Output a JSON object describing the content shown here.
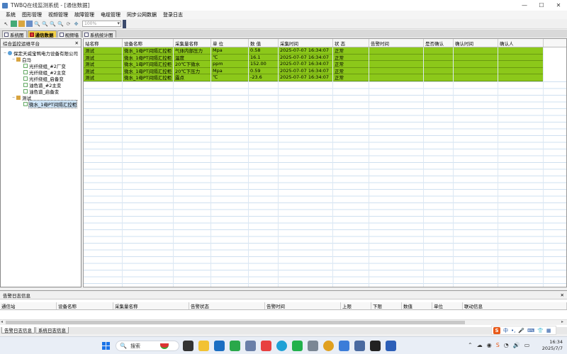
{
  "window": {
    "title": "TWBQ在线监测系统 - [通信数据]",
    "min": "—",
    "max": "☐",
    "close": "✕"
  },
  "menu": [
    "系统",
    "图形管理",
    "视频管理",
    "故障管理",
    "电缆管理",
    "同步公网数据",
    "登录日志"
  ],
  "toolbar": {
    "zoom_placeholder": "100%"
  },
  "tabs": [
    {
      "label": "系统图",
      "active": false
    },
    {
      "label": "通信数据",
      "active": true
    },
    {
      "label": "视频墙",
      "active": false
    },
    {
      "label": "系统统计图",
      "active": false
    }
  ],
  "sidebar": {
    "title": "综合监控运维平台",
    "pin": "✕",
    "tree": [
      {
        "label": "保定天威宝鸭电力设备有限公司",
        "level": 0,
        "icon": "globe",
        "exp": "−"
      },
      {
        "label": "白马",
        "level": 1,
        "icon": "house",
        "exp": "−"
      },
      {
        "label": "光纤绕组_#2厂变",
        "level": 2,
        "icon": "leaf"
      },
      {
        "label": "光纤绕组_#2主变",
        "level": 2,
        "icon": "leaf"
      },
      {
        "label": "光纤绕组_启备变",
        "level": 2,
        "icon": "leaf"
      },
      {
        "label": "油色谱_#2主变",
        "level": 2,
        "icon": "leaf"
      },
      {
        "label": "油色谱_启备变",
        "level": 2,
        "icon": "leaf"
      },
      {
        "label": "测试",
        "level": 1,
        "icon": "house",
        "exp": "−"
      },
      {
        "label": "微水_1母PT间隔汇控柜",
        "level": 2,
        "icon": "leaf",
        "selected": true
      }
    ]
  },
  "grid": {
    "columns": [
      "站名称",
      "设备名称",
      "采集量名称",
      "单 位",
      "数 值",
      "采集时间",
      "状 态",
      "告警时间",
      "是否确认",
      "确认时间",
      "确认人"
    ],
    "rows": [
      [
        "测试",
        "微水_1母PT间隔汇控柜",
        "气体内部压力",
        "Mpa",
        "0.58",
        "2025-07-07 16:34:07",
        "正常",
        "",
        "",
        "",
        ""
      ],
      [
        "测试",
        "微水_1母PT间隔汇控柜",
        "温度",
        "℃",
        "16.1",
        "2025-07-07 16:34:07",
        "正常",
        "",
        "",
        "",
        ""
      ],
      [
        "测试",
        "微水_1母PT间隔汇控柜",
        "20℃下微水",
        "ppm",
        "152.00",
        "2025-07-07 16:34:07",
        "正常",
        "",
        "",
        "",
        ""
      ],
      [
        "测试",
        "微水_1母PT间隔汇控柜",
        "20℃下压力",
        "Mpa",
        "0.59",
        "2025-07-07 16:34:07",
        "正常",
        "",
        "",
        "",
        ""
      ],
      [
        "测试",
        "微水_1母PT间隔汇控柜",
        "露点",
        "℃",
        "-23.6",
        "2025-07-07 16:34:07",
        "正常",
        "",
        "",
        "",
        ""
      ]
    ],
    "highlight_color": "#8cc81a"
  },
  "alarm": {
    "title": "告警日志信息",
    "pin": "✕",
    "columns": [
      "通信站",
      "设备名称",
      "采集量名称",
      "告警状态",
      "告警时间",
      "上限",
      "下限",
      "数值",
      "单位",
      "联动信息"
    ]
  },
  "bottom_tabs": [
    "告警日志信息",
    "系统日志信息"
  ],
  "taskbar": {
    "search": "搜索",
    "time": "16:34",
    "date": "2025/7/7",
    "ime": [
      "S",
      "中",
      "•,",
      "🎤",
      "⌨",
      "👕",
      "▦"
    ]
  }
}
